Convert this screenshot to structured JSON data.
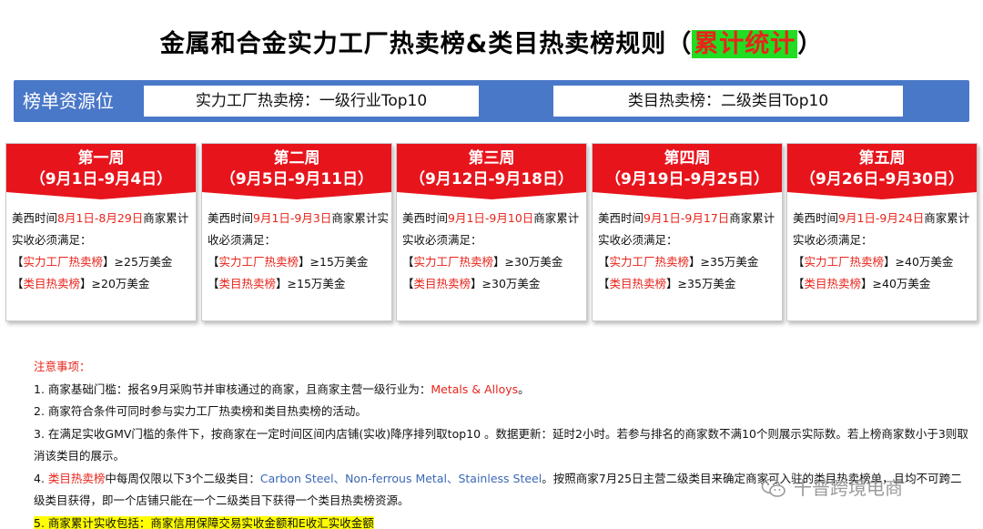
{
  "title": {
    "main": "金属和合金实力工厂热卖榜&类目热卖榜规则（",
    "highlight": "累计统计",
    "close": "）",
    "highlight_bg": "#22dd22",
    "highlight_color": "#e8241b"
  },
  "resource": {
    "label": "榜单资源位",
    "box1": "实力工厂热卖榜：一级行业Top10",
    "box2": "类目热卖榜：二级类目Top10",
    "bar_color": "#4a78c8"
  },
  "weeks": [
    {
      "name": "第一周",
      "range": "（9月1日-9月4日）",
      "prefix": "美西时间",
      "period": "8月1日-8月29日",
      "suffix": "商家累计实收必须满足：",
      "factory_tag": "实力工厂热卖榜",
      "factory_req": "≥25万美金",
      "category_tag": "类目热卖榜",
      "category_req": "≥20万美金"
    },
    {
      "name": "第二周",
      "range": "（9月5日-9月11日）",
      "prefix": "美西时间",
      "period": "9月1日-9月3日",
      "suffix": "商家累计实收必须满足：",
      "factory_tag": "实力工厂热卖榜",
      "factory_req": "≥15万美金",
      "category_tag": "类目热卖榜",
      "category_req": "≥15万美金"
    },
    {
      "name": "第三周",
      "range": "（9月12日-9月18日）",
      "prefix": "美西时间",
      "period": "9月1日-9月10日",
      "suffix": "商家累计实收必须满足：",
      "factory_tag": "实力工厂热卖榜",
      "factory_req": "≥30万美金",
      "category_tag": "类目热卖榜",
      "category_req": "≥30万美金"
    },
    {
      "name": "第四周",
      "range": "（9月19日-9月25日）",
      "prefix": "美西时间",
      "period": "9月1日-9月17日",
      "suffix": "商家累计实收必须满足：",
      "factory_tag": "实力工厂热卖榜",
      "factory_req": "≥35万美金",
      "category_tag": "类目热卖榜",
      "category_req": "≥35万美金"
    },
    {
      "name": "第五周",
      "range": "（9月26日-9月30日）",
      "prefix": "美西时间",
      "period": "9月1日-9月24日",
      "suffix": "商家累计实收必须满足：",
      "factory_tag": "实力工厂热卖榜",
      "factory_req": "≥40万美金",
      "category_tag": "类目热卖榜",
      "category_req": "≥40万美金"
    }
  ],
  "notes": {
    "heading": "注意事项：",
    "n1_prefix": "1. 商家基础门槛：报名9月采购节并审核通过的商家，且商家主营一级行业为：",
    "n1_red": "Metals & Alloys",
    "n1_suffix": "。",
    "n2": "2. 商家符合条件可同时参与实力工厂热卖榜和类目热卖榜的活动。",
    "n3": "3. 在满足实收GMV门槛的条件下，按商家在一定时间区间内店铺(实收)降序排列取top10 。数据更新：延时2小时。若参与排名的商家数不满10个则展示实际数。若上榜商家数小于3则取消该类目的展示。",
    "n4_prefix": "4. ",
    "n4_red": "类目热卖榜",
    "n4_mid": "中每周仅限以下3个二级类目：",
    "n4_blue": "Carbon Steel、Non-ferrous Metal、Stainless Steel",
    "n4_suffix": "。按照商家7月25日主营二级类目来确定商家可入驻的类目热卖榜单，且均不可跨二级类目获得，即一个店铺只能在一个二级类目下获得一个类目热卖榜资源。",
    "n5": "5. 商家累计实收包括：商家信用保障交易实收金额和E收汇实收金额"
  },
  "watermark": {
    "text": "十普跨境电商",
    "icon": "wechat-icon"
  }
}
